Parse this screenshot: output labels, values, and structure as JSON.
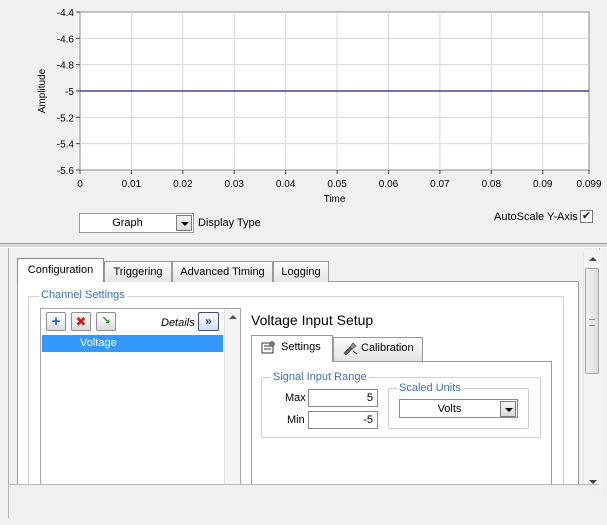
{
  "graph": {
    "y_axis_label": "Amplitude",
    "x_axis_label": "Time",
    "display_type_label": "Display Type",
    "display_type_value": "Graph",
    "autoscale_label": "AutoScale Y-Axis",
    "autoscale_checked": true
  },
  "chart_data": {
    "type": "line",
    "xlabel": "Time",
    "ylabel": "Amplitude",
    "xlim": [
      0,
      0.099
    ],
    "ylim": [
      -5.6,
      -4.4
    ],
    "x_ticks": [
      "0",
      "0.01",
      "0.02",
      "0.03",
      "0.04",
      "0.05",
      "0.06",
      "0.07",
      "0.08",
      "0.09",
      "0.099"
    ],
    "x_tick_values": [
      0,
      0.01,
      0.02,
      0.03,
      0.04,
      0.05,
      0.06,
      0.07,
      0.08,
      0.09,
      0.099
    ],
    "y_ticks": [
      "-4.4",
      "-4.6",
      "-4.8",
      "-5",
      "-5.2",
      "-5.4",
      "-5.6"
    ],
    "y_tick_values": [
      -4.4,
      -4.6,
      -4.8,
      -5,
      -5.2,
      -5.4,
      -5.6
    ],
    "grid": true,
    "series": [
      {
        "x": [
          0,
          0.099
        ],
        "values": [
          -5,
          -5
        ],
        "color": "#1f1f7a"
      }
    ]
  },
  "tabs": [
    {
      "label": "Configuration",
      "active": true
    },
    {
      "label": "Triggering",
      "active": false
    },
    {
      "label": "Advanced Timing",
      "active": false
    },
    {
      "label": "Logging",
      "active": false
    }
  ],
  "channel_settings": {
    "legend": "Channel Settings",
    "details_label": "Details",
    "channels": [
      "Voltage"
    ]
  },
  "voltage_setup": {
    "title": "Voltage Input Setup",
    "subtabs": [
      {
        "label": "Settings",
        "active": true
      },
      {
        "label": "Calibration",
        "active": false
      }
    ],
    "signal_range": {
      "legend": "Signal Input Range",
      "max_label": "Max",
      "max_value": "5",
      "min_label": "Min",
      "min_value": "-5"
    },
    "scaled_units": {
      "legend": "Scaled Units",
      "value": "Volts"
    }
  },
  "colors": {
    "accent": "#3399ff",
    "legend_text": "#3b73b9",
    "plot_line": "#1f1f7a",
    "grid": "#d6d6d6"
  }
}
